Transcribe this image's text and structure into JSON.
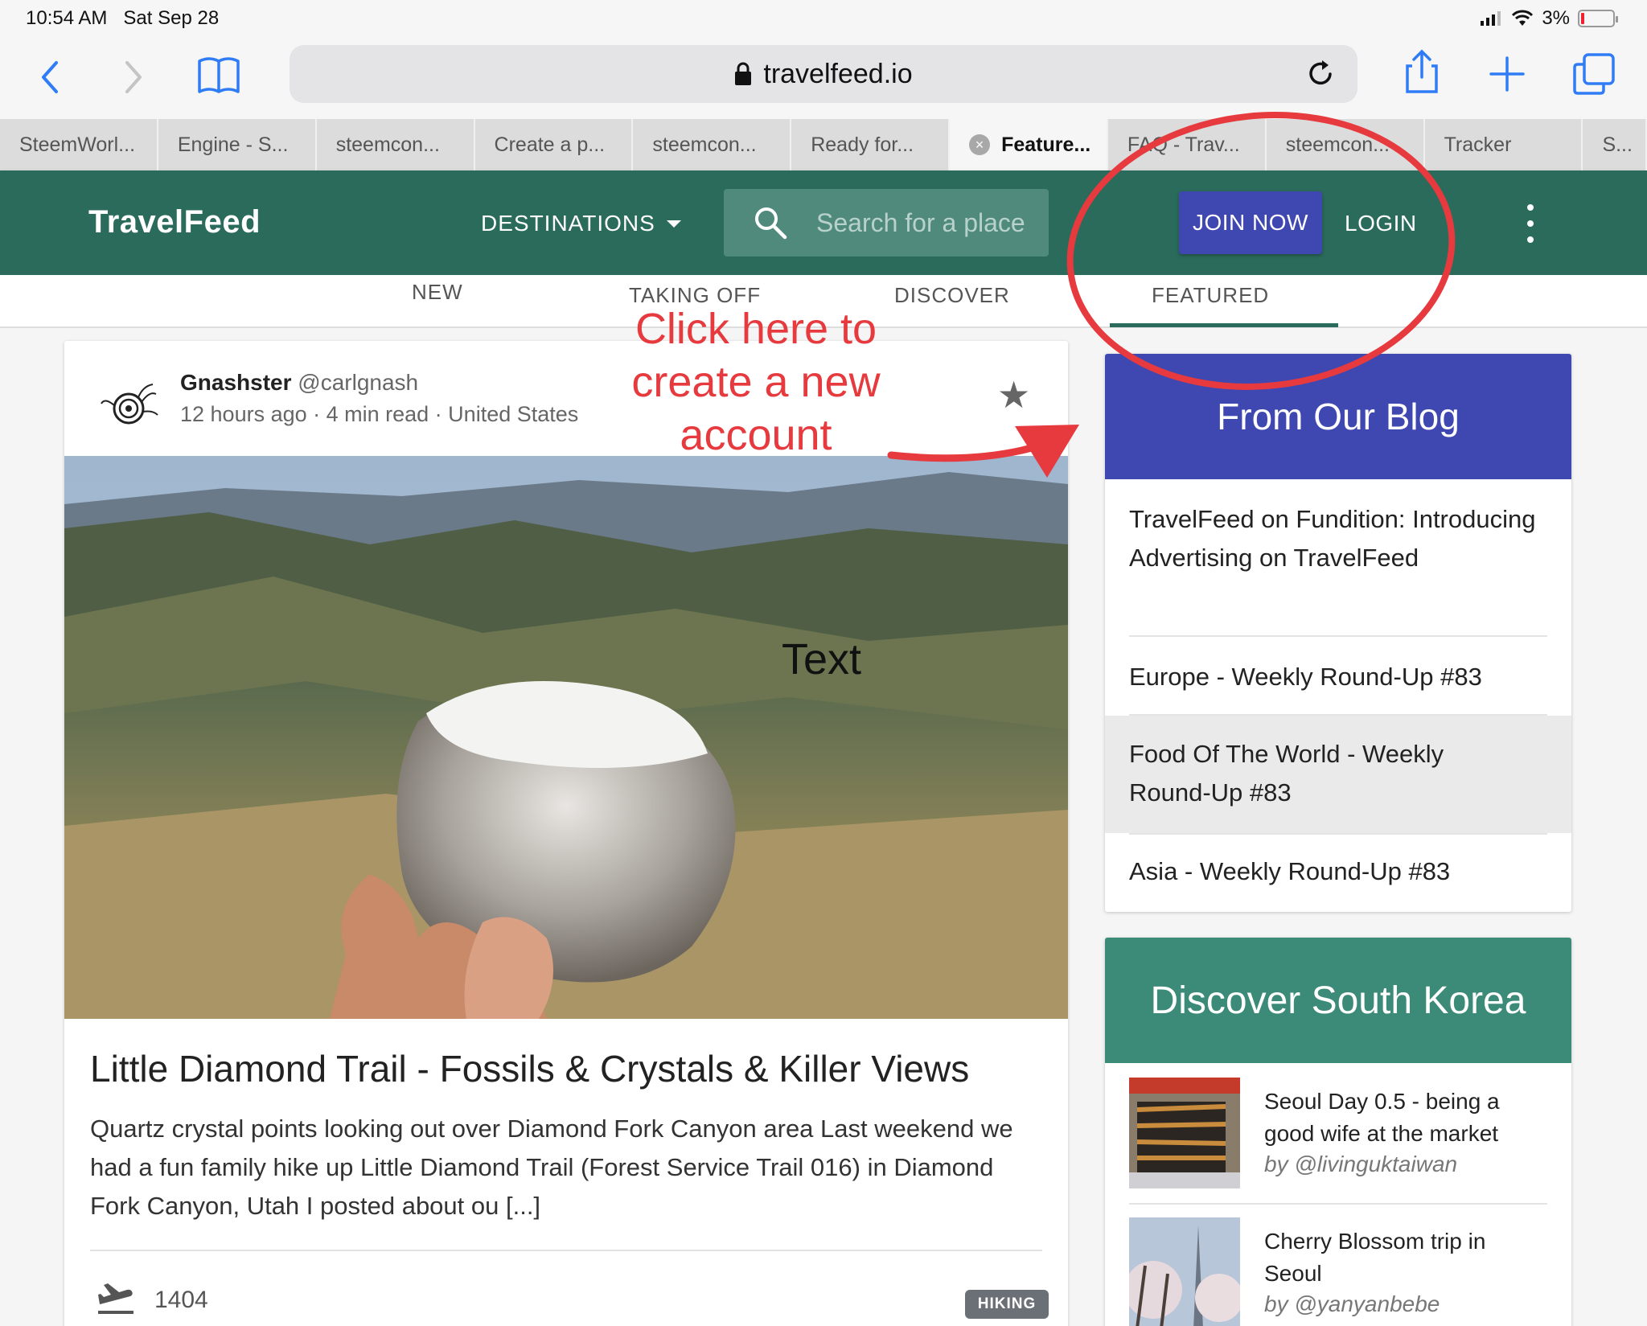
{
  "status_bar": {
    "time": "10:54 AM",
    "date": "Sat Sep 28",
    "battery": "3%"
  },
  "browser": {
    "url": "travelfeed.io",
    "tabs": [
      "SteemWorl...",
      "Engine - S...",
      "steemcon...",
      "Create a p...",
      "steemcon...",
      "Ready for...",
      "Feature...",
      "FAQ - Trav...",
      "steemcon...",
      "Tracker",
      "S..."
    ],
    "active_tab_index": 6
  },
  "header": {
    "brand": "TravelFeed",
    "destinations_label": "DESTINATIONS",
    "search_placeholder": "Search for a place",
    "join_label": "JOIN NOW",
    "login_label": "LOGIN"
  },
  "subnav": {
    "items": [
      "NEW",
      "TAKING OFF",
      "DISCOVER",
      "FEATURED"
    ],
    "active": "FEATURED"
  },
  "post": {
    "author_name": "Gnashster",
    "author_handle": "@carlgnash",
    "meta": "12 hours ago · 4 min read · United States",
    "image_overlay_text": "Text",
    "title": "Little Diamond Trail - Fossils & Crystals & Killer Views",
    "excerpt": "Quartz crystal points looking out over Diamond Fork Canyon area Last weekend we had a fun family hike up Little Diamond Trail (Forest Service Trail 016) in Diamond Fork Canyon, Utah I posted about ou [...]",
    "count": "1404",
    "tag": "HIKING"
  },
  "blog": {
    "title": "From Our Blog",
    "items": [
      "TravelFeed on Fundition: Introducing Advertising on TravelFeed",
      "Europe - Weekly Round-Up #83",
      "Food Of The World - Weekly Round-Up #83",
      "Asia - Weekly Round-Up #83"
    ]
  },
  "korea": {
    "title": "Discover South Korea",
    "items": [
      {
        "title": "Seoul Day 0.5 - being a good wife at the market",
        "by": "by @livinguktaiwan"
      },
      {
        "title": "Cherry Blossom trip in Seoul",
        "by": "by @yanyanbebe"
      }
    ]
  },
  "annotation": {
    "text": "Click here to create a new account",
    "color": "#e63a3f"
  },
  "colors": {
    "brand_green": "#2b6b5b",
    "indigo": "#3f47b0",
    "korea_green": "#3c8a78",
    "ios_blue": "#2f7cf6"
  }
}
